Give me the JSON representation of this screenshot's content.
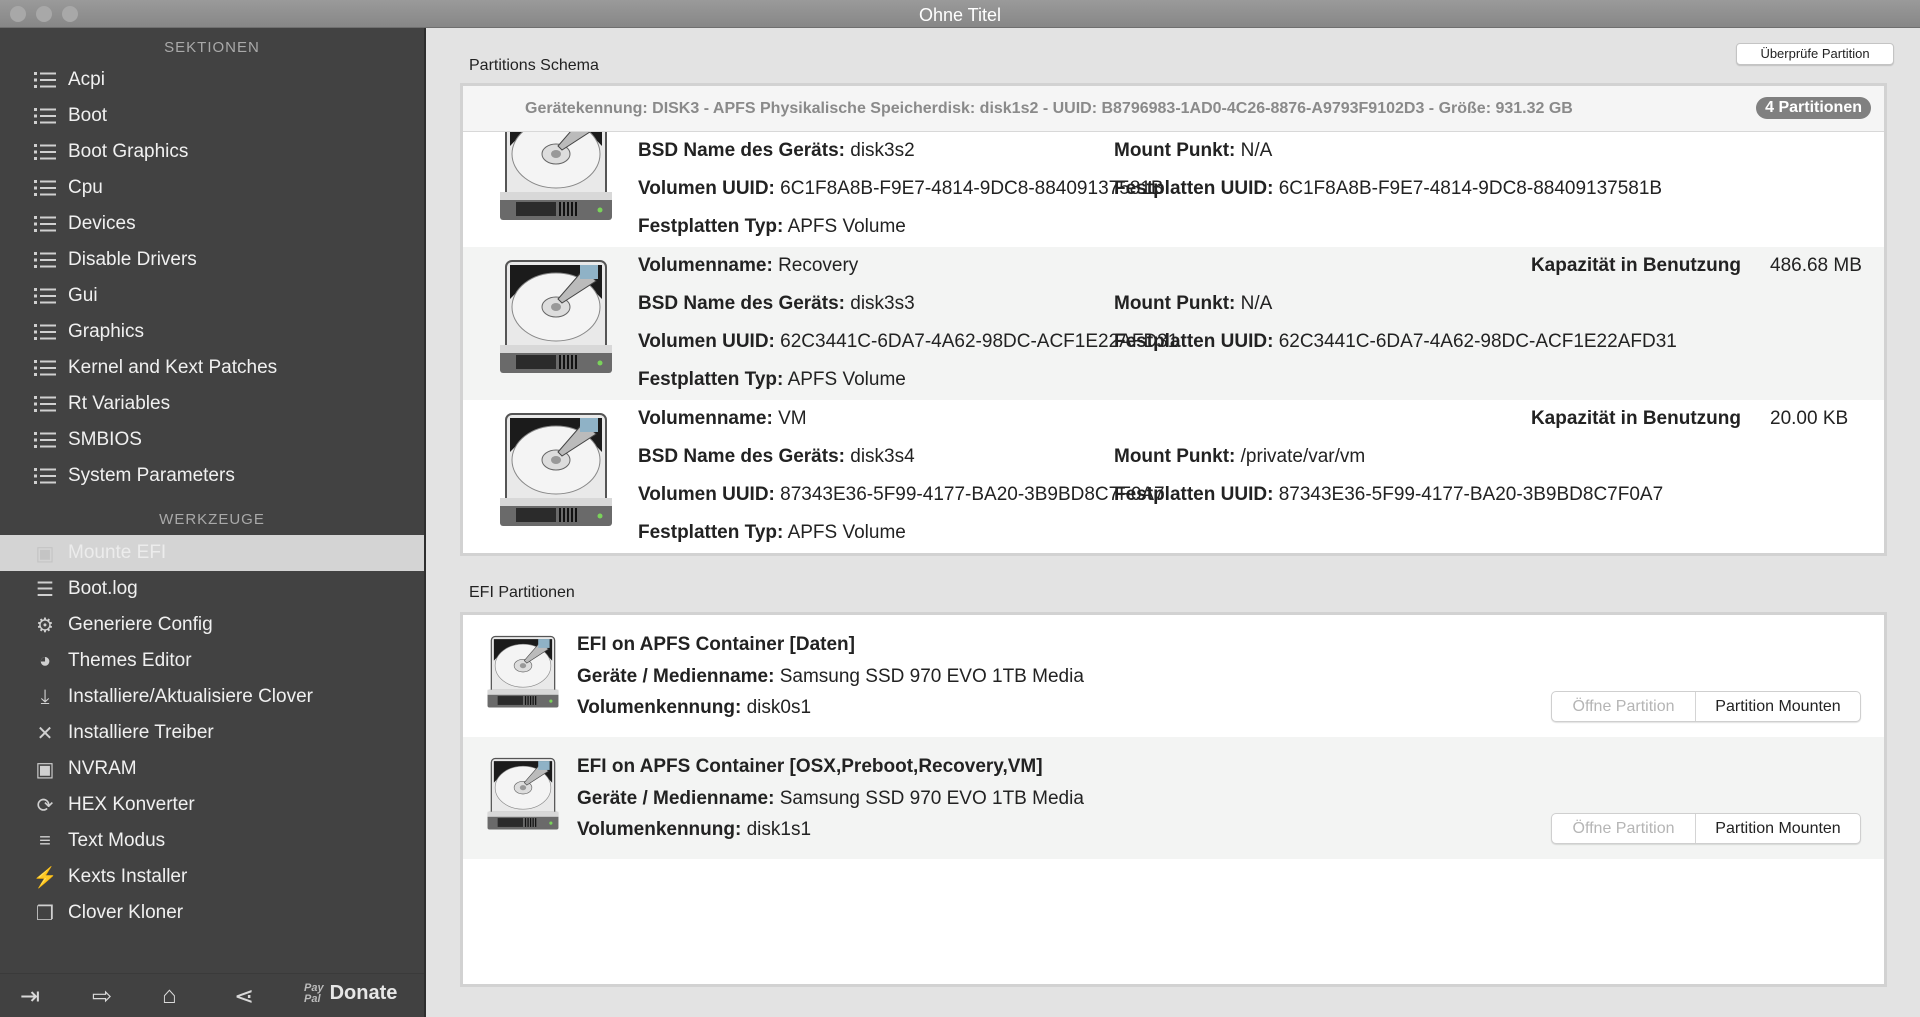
{
  "window": {
    "title": "Ohne Titel"
  },
  "sidebar": {
    "sections_header": "SEKTIONEN",
    "sections": [
      {
        "label": "Acpi"
      },
      {
        "label": "Boot"
      },
      {
        "label": "Boot Graphics"
      },
      {
        "label": "Cpu"
      },
      {
        "label": "Devices"
      },
      {
        "label": "Disable Drivers"
      },
      {
        "label": "Gui"
      },
      {
        "label": "Graphics"
      },
      {
        "label": "Kernel and Kext Patches"
      },
      {
        "label": "Rt Variables"
      },
      {
        "label": "SMBIOS"
      },
      {
        "label": "System Parameters"
      }
    ],
    "tools_header": "WERKZEUGE",
    "tools": [
      {
        "label": "Mounte EFI",
        "icon": "disk-icon",
        "selected": true
      },
      {
        "label": "Boot.log",
        "icon": "log-search-icon"
      },
      {
        "label": "Generiere Config",
        "icon": "gears-icon"
      },
      {
        "label": "Themes Editor",
        "icon": "palette-icon"
      },
      {
        "label": "Installiere/Aktualisiere Clover",
        "icon": "download-icon"
      },
      {
        "label": "Installiere Treiber",
        "icon": "tools-icon"
      },
      {
        "label": "NVRAM",
        "icon": "chip-icon"
      },
      {
        "label": "HEX Konverter",
        "icon": "refresh-icon"
      },
      {
        "label": "Text Modus",
        "icon": "text-lines-icon"
      },
      {
        "label": "Kexts Installer",
        "icon": "plug-icon"
      },
      {
        "label": "Clover Kloner",
        "icon": "clone-icon"
      }
    ],
    "footer": {
      "donate_label": "Donate",
      "paypal_top": "Pay",
      "paypal_bottom": "Pal"
    }
  },
  "partitions": {
    "section_label": "Partitions Schema",
    "check_button": "Überprüfe Partition",
    "header": "Gerätekennung: DISK3 - APFS Physikalische Speicherdisk: disk1s2 - UUID: B8796983-1AD0-4C26-8876-A9793F9102D3 - Größe: 931.32 GB",
    "badge": "4 Partitionen",
    "labels": {
      "volname": "Volumenname:",
      "bsd": "BSD Name des Geräts:",
      "voluuid": "Volumen UUID:",
      "type": "Festplatten Typ:",
      "capacity": "Kapazität in Benutzung",
      "mount": "Mount Punkt:",
      "diskuuid": "Festplatten UUID:"
    },
    "rows": [
      {
        "bsd": "disk3s2",
        "voluuid": "6C1F8A8B-F9E7-4814-9DC8-88409137581B",
        "type": "APFS Volume",
        "mount": "N/A",
        "diskuuid": "6C1F8A8B-F9E7-4814-9DC8-88409137581B"
      },
      {
        "volname": "Recovery",
        "bsd": "disk3s3",
        "voluuid": "62C3441C-6DA7-4A62-98DC-ACF1E22AFD31",
        "type": "APFS Volume",
        "capacity": "486.68 MB",
        "mount": "N/A",
        "diskuuid": "62C3441C-6DA7-4A62-98DC-ACF1E22AFD31"
      },
      {
        "volname": "VM",
        "bsd": "disk3s4",
        "voluuid": "87343E36-5F99-4177-BA20-3B9BD8C7F0A7",
        "type": "APFS Volume",
        "capacity": "20.00 KB",
        "mount": "/private/var/vm",
        "diskuuid": "87343E36-5F99-4177-BA20-3B9BD8C7F0A7"
      }
    ]
  },
  "efi": {
    "section_label": "EFI Partitionen",
    "labels": {
      "media": "Geräte / Medienname:",
      "volid": "Volumenkennung:"
    },
    "open_label": "Öffne Partition",
    "mount_label": "Partition Mounten",
    "rows": [
      {
        "title": "EFI on APFS Container [Daten]",
        "media": "Samsung SSD 970 EVO 1TB Media",
        "volid": "disk0s1"
      },
      {
        "title": "EFI on APFS Container [OSX,Preboot,Recovery,VM]",
        "media": "Samsung SSD 970 EVO 1TB Media",
        "volid": "disk1s1"
      }
    ]
  }
}
